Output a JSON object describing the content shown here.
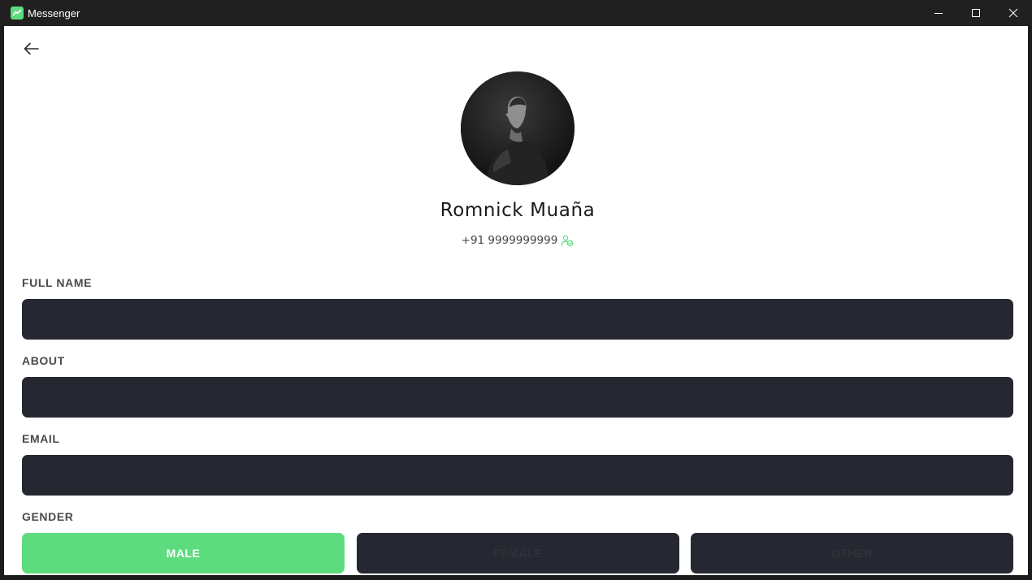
{
  "window": {
    "title": "Messenger",
    "accent_color": "#5ddc7f"
  },
  "profile": {
    "name": "Romnick Muaña",
    "phone": "+91 9999999999",
    "verified_icon": "user-verified-icon"
  },
  "form": {
    "full_name": {
      "label": "FULL NAME",
      "value": ""
    },
    "about": {
      "label": "ABOUT",
      "value": ""
    },
    "email": {
      "label": "EMAIL",
      "value": ""
    },
    "gender": {
      "label": "GENDER",
      "options": [
        "MALE",
        "FEMALE",
        "OTHER"
      ],
      "selected": "MALE"
    }
  },
  "colors": {
    "input_bg": "#262831",
    "active": "#5ddc7f",
    "label": "#4a4a4a"
  }
}
